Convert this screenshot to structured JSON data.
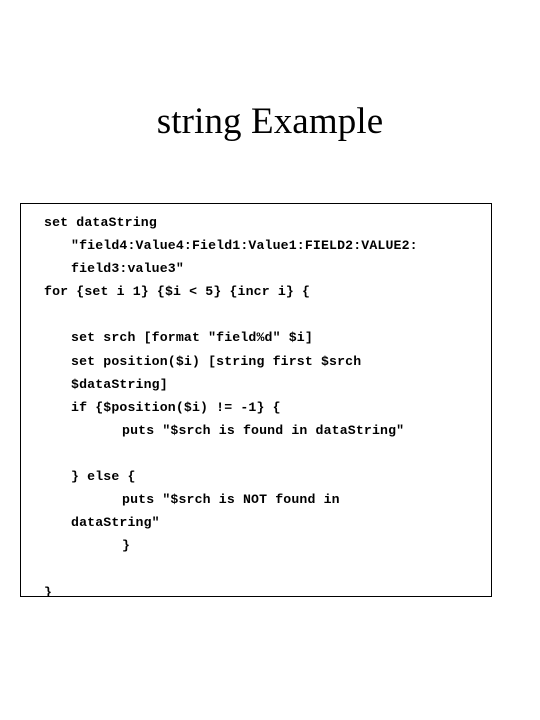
{
  "slide": {
    "title": "string Example",
    "background_color": "#ffffff",
    "text_color": "#000000"
  },
  "code_box": {
    "border_color": "#000000",
    "background_color": "#ffffff",
    "language": "tcl",
    "lines": [
      {
        "text": "set dataString",
        "indent": 0
      },
      {
        "text": "\"field4:Value4:Field1:Value1:FIELD2:VALUE2:",
        "indent": 3
      },
      {
        "text": "field3:value3\"",
        "indent": 3
      },
      {
        "text": "for {set i 1} {$i < 5} {incr i} {",
        "indent": 0
      },
      {
        "text": "",
        "indent": 0
      },
      {
        "text": "set srch [format \"field%d\" $i]",
        "indent": 3
      },
      {
        "text": "set position($i) [string first $srch",
        "indent": 3
      },
      {
        "text": "$dataString]",
        "indent": 3
      },
      {
        "text": "if {$position($i) != -1} {",
        "indent": 3
      },
      {
        "text": "puts \"$srch is found in dataString\"",
        "indent": 9
      },
      {
        "text": "",
        "indent": 0
      },
      {
        "text": "} else {",
        "indent": 3
      },
      {
        "text": "puts \"$srch is NOT found in",
        "indent": 9
      },
      {
        "text": "dataString\"",
        "indent": 3
      },
      {
        "text": "}",
        "indent": 9
      },
      {
        "text": "",
        "indent": 0
      },
      {
        "text": "}",
        "indent": 0
      }
    ]
  }
}
